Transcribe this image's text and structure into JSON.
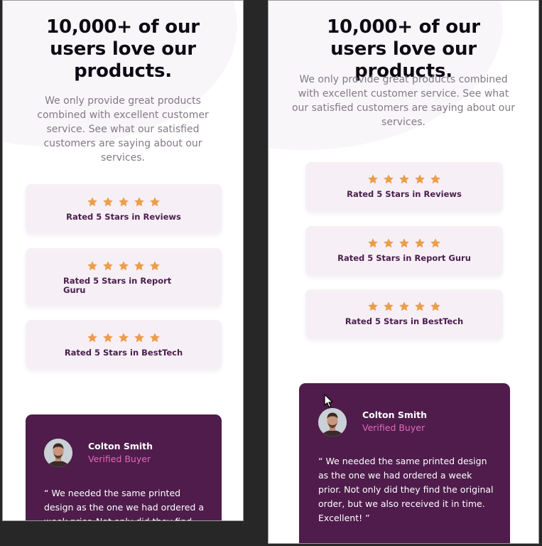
{
  "headline_mobile": "10,000+ of our users love our products.",
  "headline_desktop": "10,000+ of our users love our products.",
  "intro": "We only provide great products combined with excellent customer service. See what our satisfied customers are saying about our services.",
  "ratings": [
    {
      "label": "Rated 5 Stars in Reviews",
      "stars": 5
    },
    {
      "label": "Rated 5 Stars in Report Guru",
      "stars": 5
    },
    {
      "label": "Rated 5 Stars in BestTech",
      "stars": 5
    }
  ],
  "testimonial": {
    "name": "Colton Smith",
    "role": "Verified Buyer",
    "quote": "“ We needed the same printed design as the one we had ordered a week prior. Not only did they find the original order, but we also received it in time. Excellent! ”"
  },
  "colors": {
    "page_background": "#272727",
    "headline": "#0d0a14",
    "body_text": "#847a86",
    "card_background": "#f6f0f6",
    "card_text": "#4a1d4c",
    "star": "#ee9d4a",
    "testimonial_background": "#4f1c4c",
    "testimonial_role": "#e06bb3"
  },
  "icons": {
    "star": "star-icon",
    "avatar": "avatar",
    "cursor": "mouse-pointer-icon"
  }
}
